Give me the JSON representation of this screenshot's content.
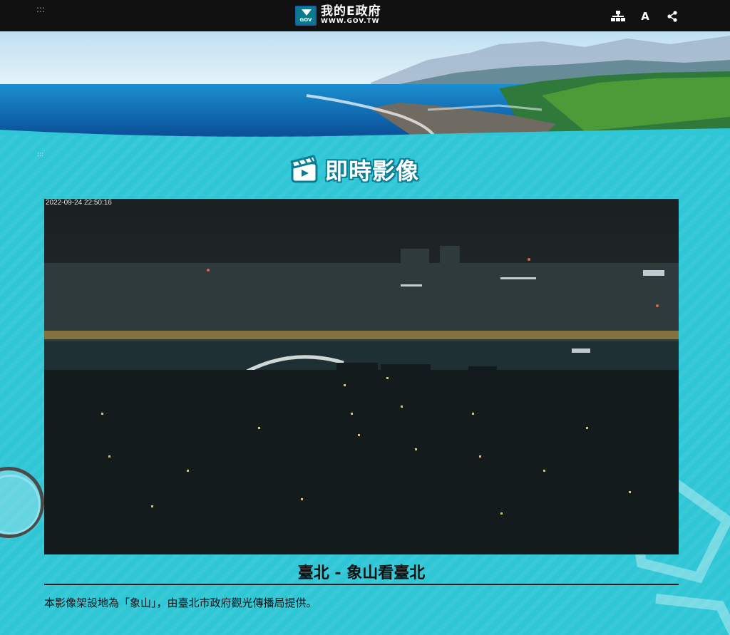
{
  "header": {
    "accesskey_label": ":::",
    "logo": {
      "badge_text": "GOV",
      "title": "我的E政府",
      "url": "WWW.GOV.TW"
    },
    "tools": [
      {
        "name": "sitemap-icon",
        "glyph": "⊞"
      },
      {
        "name": "font-size-icon",
        "glyph": "A"
      },
      {
        "name": "share-icon",
        "glyph": "⋖"
      }
    ]
  },
  "content": {
    "accesskey_label": ":::",
    "section_title": "即時影像",
    "camera": {
      "timestamp": "2022-09-24 22:50:16"
    },
    "caption": {
      "title": "臺北 - 象山看臺北",
      "description": "本影像架設地為「象山」，由臺北市政府觀光傳播局提供。"
    }
  },
  "colors": {
    "page_bg": "#2fc6d6",
    "topbar_bg": "#111111",
    "title_stroke": "#0a7f94"
  }
}
